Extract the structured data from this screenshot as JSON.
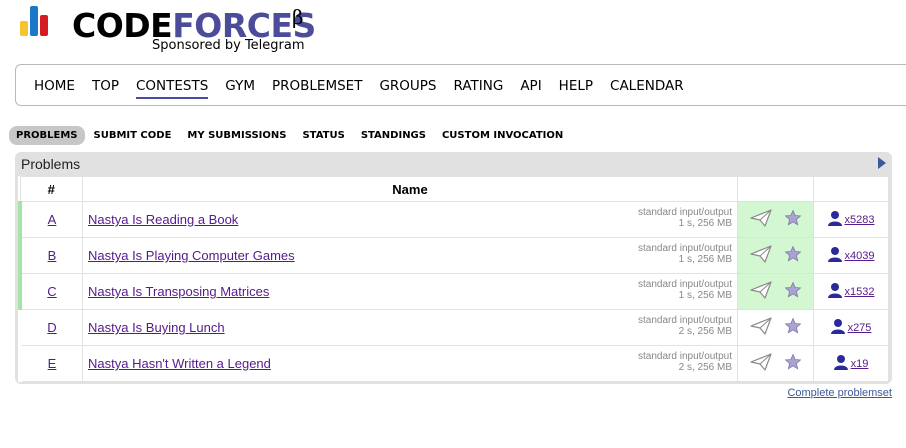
{
  "logo": {
    "word_part1": "CODE",
    "word_part2": "FORCES",
    "beta": "β",
    "sponsor": "Sponsored by Telegram",
    "bar_colors": [
      "#f6c431",
      "#1b77c8",
      "#d51c23"
    ]
  },
  "main_menu": {
    "items": [
      "HOME",
      "TOP",
      "CONTESTS",
      "GYM",
      "PROBLEMSET",
      "GROUPS",
      "RATING",
      "API",
      "HELP",
      "CALENDAR"
    ],
    "active": "CONTESTS"
  },
  "second_menu": {
    "items": [
      "PROBLEMS",
      "SUBMIT CODE",
      "MY SUBMISSIONS",
      "STATUS",
      "STANDINGS",
      "CUSTOM INVOCATION"
    ],
    "active": "PROBLEMS"
  },
  "problems_box": {
    "title": "Problems",
    "headers": {
      "index": "#",
      "name": "Name",
      "actions": "",
      "solved": ""
    },
    "rows": [
      {
        "index": "A",
        "name": "Nastya Is Reading a Book",
        "io": "standard input/output",
        "limits": "1 s, 256 MB",
        "solved": "x5283",
        "accepted": true
      },
      {
        "index": "B",
        "name": "Nastya Is Playing Computer Games",
        "io": "standard input/output",
        "limits": "1 s, 256 MB",
        "solved": "x4039",
        "accepted": true
      },
      {
        "index": "C",
        "name": "Nastya Is Transposing Matrices",
        "io": "standard input/output",
        "limits": "1 s, 256 MB",
        "solved": "x1532",
        "accepted": true
      },
      {
        "index": "D",
        "name": "Nastya Is Buying Lunch",
        "io": "standard input/output",
        "limits": "2 s, 256 MB",
        "solved": "x275",
        "accepted": false
      },
      {
        "index": "E",
        "name": "Nastya Hasn't Written a Legend",
        "io": "standard input/output",
        "limits": "2 s, 256 MB",
        "solved": "x19",
        "accepted": false
      }
    ],
    "icons": {
      "submit": "paper-plane-icon",
      "favourite": "star-icon",
      "solved_users": "user-icon"
    },
    "colors": {
      "accepted_bg": "#d3f7d0",
      "accepted_border": "#a6e3a4",
      "link": "#551a8b"
    }
  },
  "complete_problemset": "Complete problemset"
}
